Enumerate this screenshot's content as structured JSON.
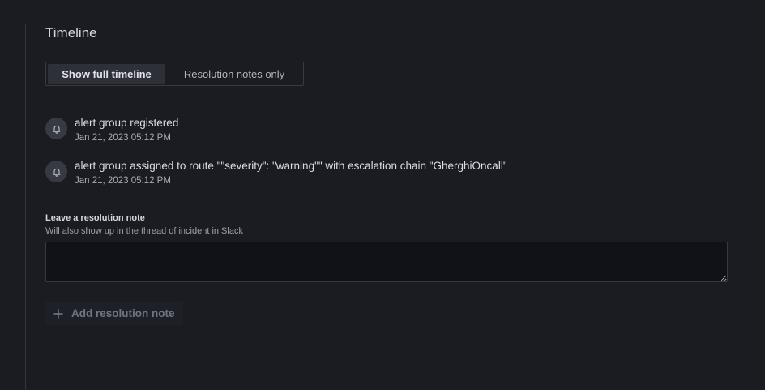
{
  "timeline": {
    "title": "Timeline",
    "filter": {
      "options": [
        "Show full timeline",
        "Resolution notes only"
      ],
      "selected": "Show full timeline"
    },
    "events": [
      {
        "icon": "bell-icon",
        "text": "alert group registered",
        "time": "Jan 21, 2023 05:12 PM"
      },
      {
        "icon": "bell-icon",
        "text": "alert group assigned to route \"\"severity\": \"warning\"\" with escalation chain \"GherghiOncall\"",
        "time": "Jan 21, 2023 05:12 PM"
      }
    ]
  },
  "resolution_note": {
    "label": "Leave a resolution note",
    "hint": "Will also show up in the thread of incident in Slack",
    "value": "",
    "button_label": "Add resolution note",
    "button_icon": "plus-icon"
  }
}
